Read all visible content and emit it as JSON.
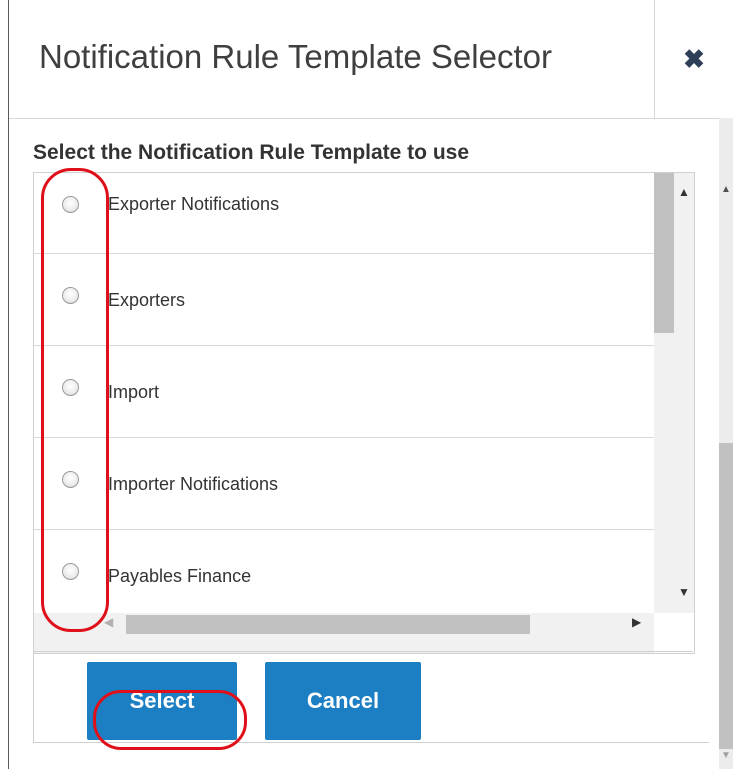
{
  "dialog": {
    "title": "Notification Rule Template Selector",
    "close_icon": "close-icon",
    "prompt": "Select the Notification Rule Template to use"
  },
  "templates": [
    {
      "label": "Exporter Notifications",
      "selected": false
    },
    {
      "label": "Exporters",
      "selected": false
    },
    {
      "label": "Import",
      "selected": false
    },
    {
      "label": "Importer Notifications",
      "selected": false
    },
    {
      "label": "Payables Finance",
      "selected": false
    }
  ],
  "buttons": {
    "select_label": "Select",
    "cancel_label": "Cancel"
  },
  "colors": {
    "button": "#1c7fc3",
    "highlight": "#e0101a",
    "title_text": "#3f3f3f"
  }
}
